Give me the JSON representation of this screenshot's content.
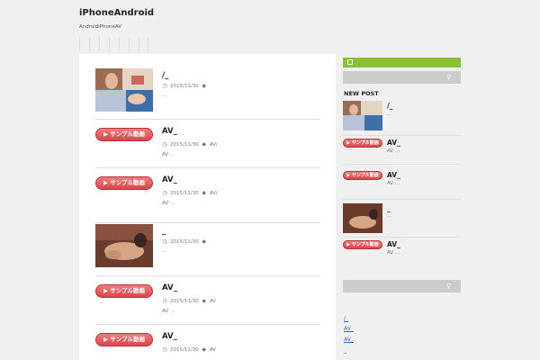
{
  "site": {
    "title": "iPhoneAndroid",
    "description": "AndroidiPhoneAV"
  },
  "posts": [
    {
      "title": "/_",
      "date": "2015/11/30",
      "tag": "",
      "excerpt": "...",
      "thumb": "photo"
    },
    {
      "title": "AV_",
      "date": "2015/11/30",
      "tag": "AV/",
      "excerpt": "AV ...",
      "thumb": "badge",
      "badge_label": "▶ サンプル動画"
    },
    {
      "title": "AV_",
      "date": "2015/11/30",
      "tag": "AV/",
      "excerpt": "AV ...",
      "thumb": "badge",
      "badge_label": "▶ サンプル動画"
    },
    {
      "title": "_",
      "date": "2015/11/30",
      "tag": "",
      "excerpt": "...",
      "thumb": "photo"
    },
    {
      "title": "AV_",
      "date": "2015/11/30",
      "tag": "AV",
      "excerpt": "AV ...",
      "thumb": "badge",
      "badge_label": "▶ サンプル動画"
    },
    {
      "title": "AV_",
      "date": "2015/11/30",
      "tag": "AV",
      "excerpt": "",
      "thumb": "badge",
      "badge_label": "▶ サンプル動画"
    }
  ],
  "sidebar": {
    "new_post_heading": "NEW POST",
    "items": [
      {
        "title": "/_",
        "excerpt": "...",
        "thumb": "photo"
      },
      {
        "title": "AV_",
        "excerpt": "AV ...",
        "thumb": "badge",
        "badge_label": "▶ サンプル動画"
      },
      {
        "title": "AV_",
        "excerpt": "AV ...",
        "thumb": "badge",
        "badge_label": "▶ サンプル動画"
      },
      {
        "title": "_",
        "excerpt": "...",
        "thumb": "photo"
      },
      {
        "title": "AV_",
        "excerpt": "AV ...",
        "thumb": "badge",
        "badge_label": "▶ サンプル動画"
      }
    ],
    "links": [
      "/_",
      "AV_",
      "AV_",
      "_"
    ]
  },
  "colors": {
    "accent_green": "#88c136",
    "badge_red": "#d9454d",
    "link_blue": "#3366cc"
  },
  "icons": {
    "clock": "clock-icon",
    "tag": "tag-icon",
    "search": "search-icon",
    "rss": "rss-icon"
  }
}
